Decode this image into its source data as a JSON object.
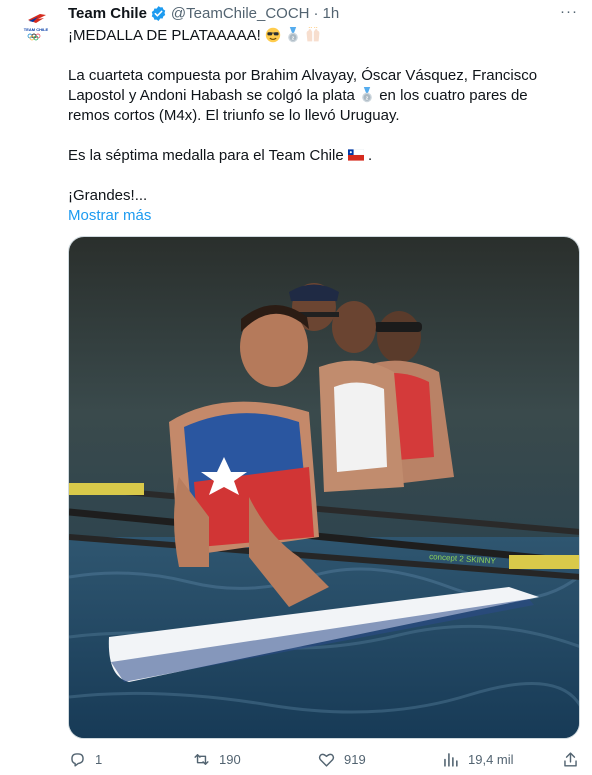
{
  "tweet": {
    "author_name": "Team Chile",
    "handle": "@TeamChile_COCH",
    "dot": "·",
    "time": "1h",
    "more": "···",
    "avatar_label": "TEAM CHILE",
    "text": {
      "line1": "¡MEDALLA DE PLATAAAAA!",
      "para2_a": "La cuarteta compuesta por Brahim Alvayay, Óscar Vásquez, Francisco Lapostol y Andoni Habash se colgó la plata",
      "para2_b": "en los cuatro pares de remos cortos (M4x). El triunfo se lo llevó Uruguay.",
      "para3_a": "Es la séptima medalla para el Team Chile",
      "para3_b": ".",
      "para4": "¡Grandes!..."
    },
    "show_more": "Mostrar más",
    "media": {
      "boat_brand": "concept 2 SKINNY"
    }
  },
  "actions": {
    "reply": "1",
    "retweet": "190",
    "like": "919",
    "views": "19,4 mil"
  },
  "colors": {
    "accent": "#1d9bf0",
    "secondary_text": "#536471"
  }
}
